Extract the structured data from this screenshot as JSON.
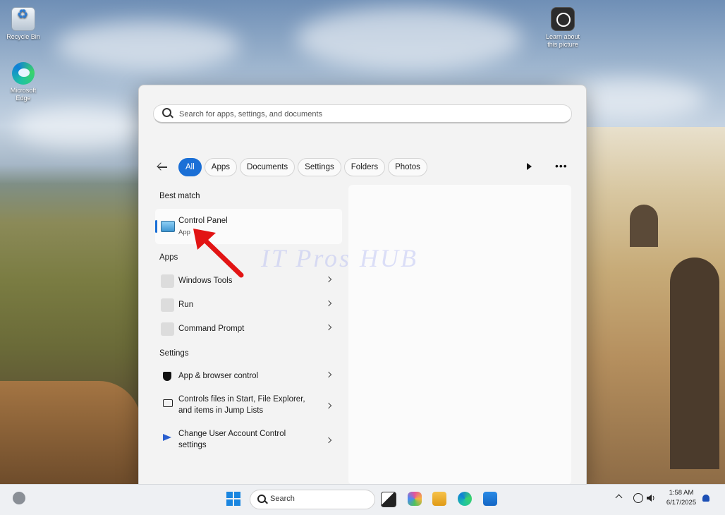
{
  "desktop": {
    "icons": [
      {
        "label": "Recycle Bin",
        "icon": "recycle-bin-icon"
      },
      {
        "label": "Microsoft Edge",
        "icon": "edge-icon"
      },
      {
        "label": "Learn about this picture",
        "icon": "learn-about-picture-icon"
      }
    ],
    "watermark": "IT Pros HUB"
  },
  "search": {
    "placeholder": "Search for apps, settings, and documents",
    "filters": [
      "All",
      "Apps",
      "Documents",
      "Settings",
      "Folders",
      "Photos"
    ],
    "active_filter": "All"
  },
  "results": {
    "best_match_title": "Best match",
    "best_match": {
      "name": "Control Panel",
      "type": "App"
    },
    "apps_title": "Apps",
    "apps": [
      "Windows Tools",
      "Run",
      "Command Prompt"
    ],
    "settings_title": "Settings",
    "settings": [
      "App & browser control",
      "Controls files in Start, File Explorer, and items in Jump Lists",
      "Change User Account Control settings"
    ]
  },
  "taskbar": {
    "search_label": "Search",
    "time": "1:58 AM",
    "date": "6/17/2025",
    "accent": "#1a6fd6"
  }
}
